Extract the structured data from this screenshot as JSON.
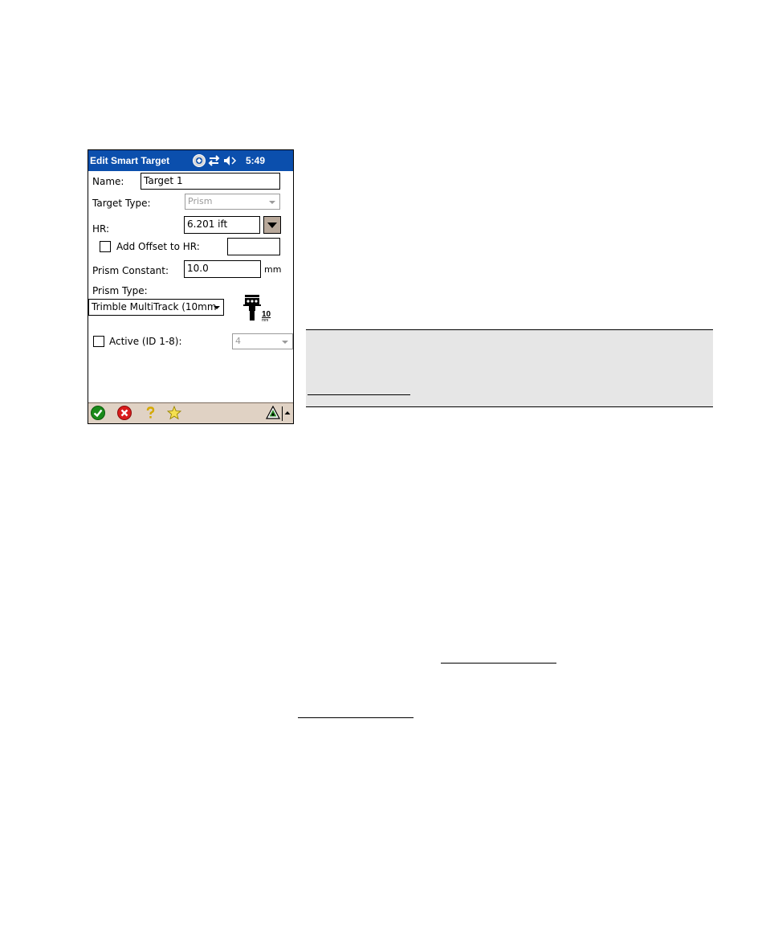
{
  "window": {
    "title": "Edit Smart Target",
    "clock": "5:49"
  },
  "form": {
    "name_label": "Name:",
    "name_value": "Target 1",
    "target_type_label": "Target Type:",
    "target_type_value": "Prism",
    "hr_label": "HR:",
    "hr_value": "6.201 ift",
    "add_offset_label": "Add Offset to HR:",
    "add_offset_checked": false,
    "add_offset_value": "",
    "prism_constant_label": "Prism Constant:",
    "prism_constant_value": "10.0",
    "prism_constant_unit": "mm",
    "prism_type_label": "Prism Type:",
    "prism_type_value": "Trimble MultiTrack (10mm",
    "prism_icon_text": "10",
    "prism_icon_unit": "mm",
    "active_label": "Active (ID 1-8):",
    "active_checked": false,
    "active_id_value": "4"
  },
  "toolbar": {
    "icons": [
      "accept-icon",
      "cancel-icon",
      "help-icon",
      "favorite-star-icon",
      "mode-triangle-icon",
      "up-arrow-icon"
    ]
  },
  "colors": {
    "titlebar": "#0b4fad",
    "toolbar": "#e0d2c4",
    "note_box": "#e6e6e6"
  }
}
